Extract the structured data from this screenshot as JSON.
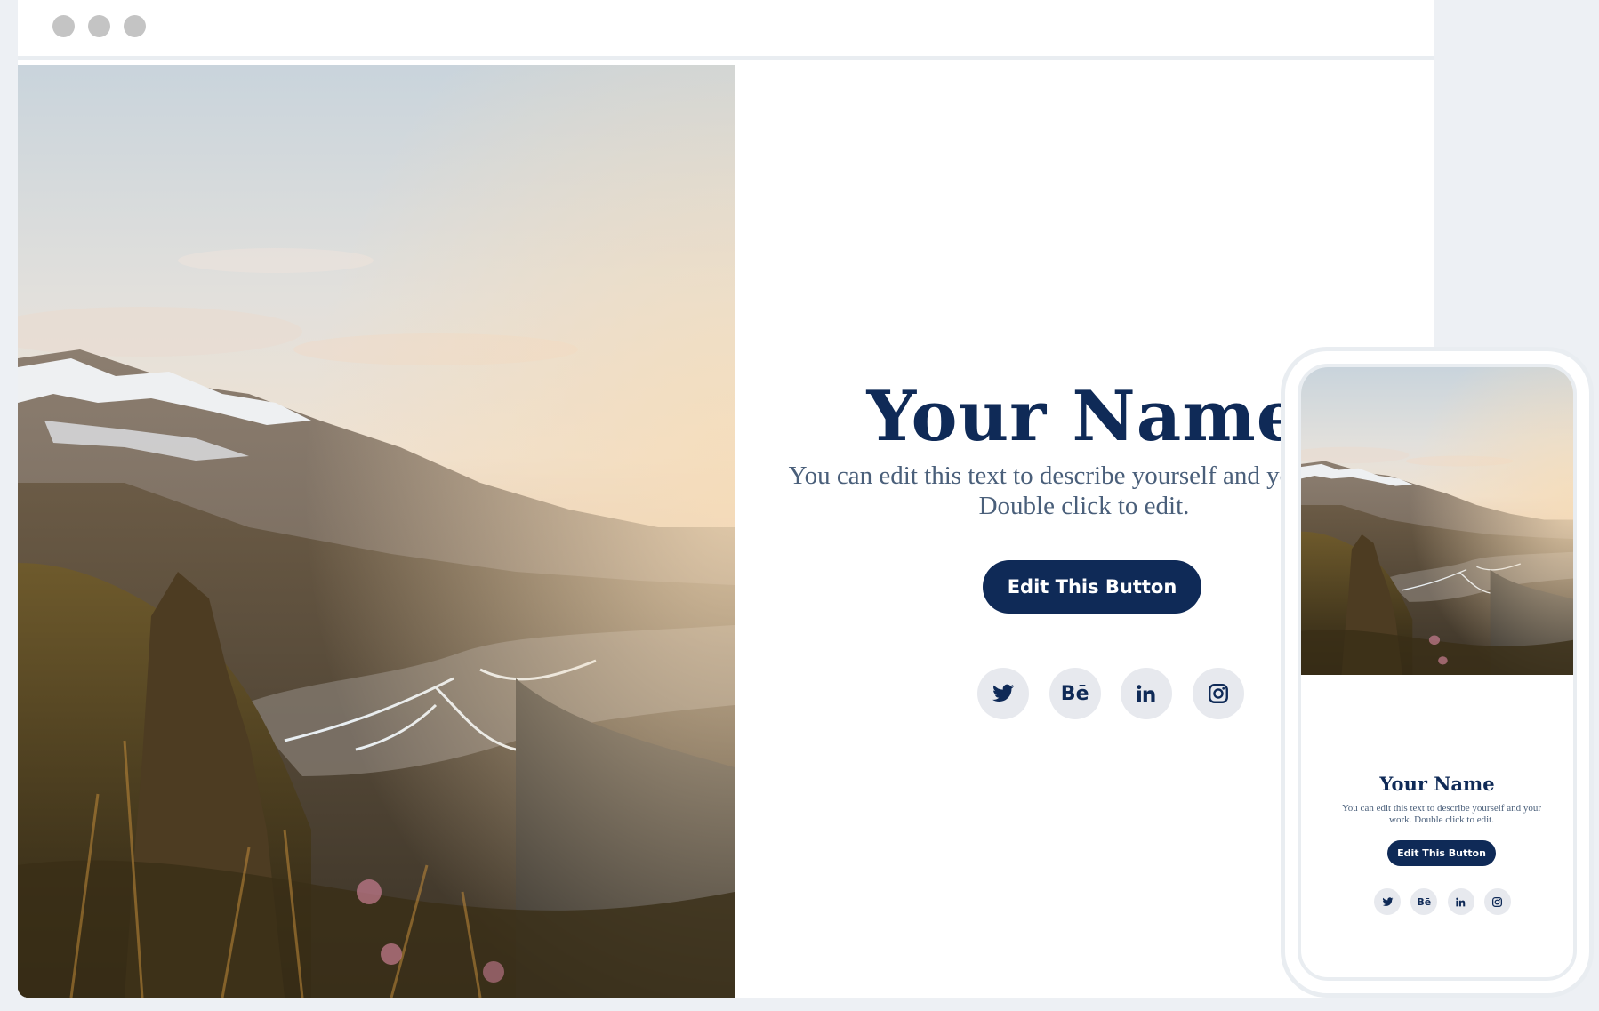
{
  "theme": {
    "brand_color": "#0f2a57",
    "page_bg": "#edf0f4"
  },
  "browser": {
    "window_controls": [
      "close-dot",
      "minimize-dot",
      "maximize-dot"
    ],
    "hero_image": "mountain-valley-photo"
  },
  "desktop": {
    "name": "Your Name",
    "bio": "You can edit this text to describe yourself and your work. Double click to edit.",
    "button_label": "Edit This Button",
    "socials": [
      {
        "id": "twitter",
        "icon": "twitter-icon",
        "glyph": ""
      },
      {
        "id": "behance",
        "icon": "behance-icon",
        "glyph": "Bē"
      },
      {
        "id": "linkedin",
        "icon": "linkedin-icon",
        "glyph": "in"
      },
      {
        "id": "instagram",
        "icon": "instagram-icon",
        "glyph": ""
      }
    ]
  },
  "mobile": {
    "name": "Your Name",
    "bio": "You can edit this text to describe yourself and your work. Double click to edit.",
    "button_label": "Edit This Button",
    "socials": [
      {
        "id": "twitter",
        "icon": "twitter-icon",
        "glyph": ""
      },
      {
        "id": "behance",
        "icon": "behance-icon",
        "glyph": "Bē"
      },
      {
        "id": "linkedin",
        "icon": "linkedin-icon",
        "glyph": "in"
      },
      {
        "id": "instagram",
        "icon": "instagram-icon",
        "glyph": ""
      }
    ]
  }
}
